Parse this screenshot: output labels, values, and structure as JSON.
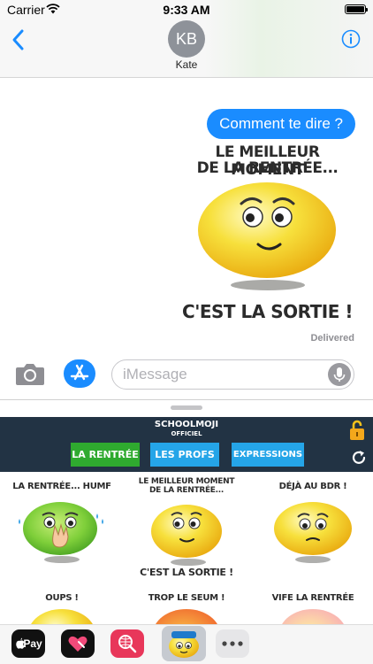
{
  "status_bar": {
    "carrier": "Carrier",
    "time": "9:33 AM"
  },
  "header": {
    "avatar_initials": "KB",
    "contact_name": "Kate"
  },
  "conversation": {
    "message": "Comment te dire ?",
    "sticker": {
      "top_line1": "LE MEILLEUR MOMENT",
      "top_line2": "DE LA RENTRÉE...",
      "bottom": "C'EST LA SORTIE !"
    },
    "delivered": "Delivered"
  },
  "input": {
    "placeholder": "iMessage"
  },
  "app": {
    "title": "SCHOOLMOJI",
    "subtitle": "OFFICIEL",
    "tabs": [
      "LA RENTRÉE",
      "LES PROFS",
      "EXPRESSIONS"
    ],
    "stickers": [
      {
        "label": "LA RENTRÉE... HUMF",
        "label2": "",
        "caption": ""
      },
      {
        "label": "LE MEILLEUR MOMENT",
        "label2": "DE LA RENTRÉE...",
        "caption": "C'EST LA SORTIE !"
      },
      {
        "label": "DÉJÀ AU BDR !",
        "label2": "",
        "caption": ""
      },
      {
        "label": "OUPS !",
        "label2": "",
        "caption": ""
      },
      {
        "label": "TROP LE SEUM !",
        "label2": "",
        "caption": ""
      },
      {
        "label": "VIFE LA RENTRÉE",
        "label2": "",
        "caption": ""
      }
    ]
  },
  "app_bar": {
    "pay_label": "Pay"
  },
  "colors": {
    "bubble_blue": "#1a8cff",
    "app_header": "#223344",
    "tab_green": "#2faa2f",
    "tab_blue": "#25a5e8"
  }
}
